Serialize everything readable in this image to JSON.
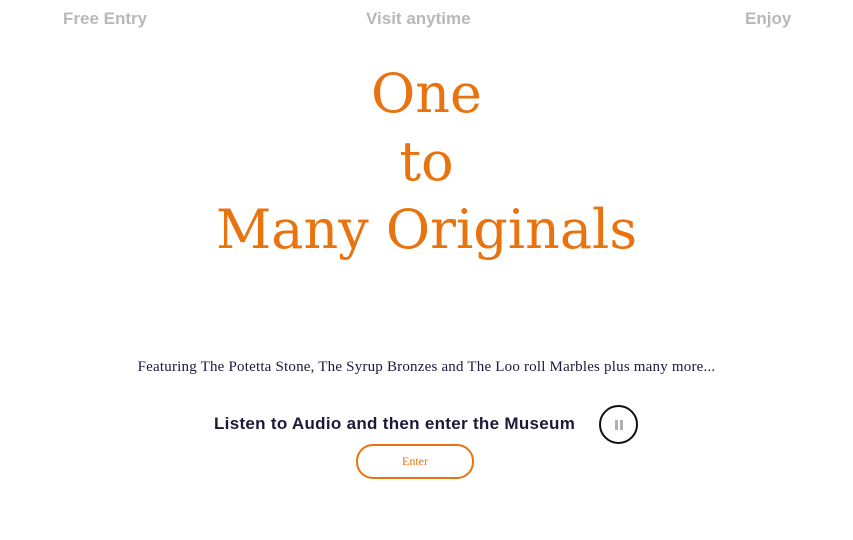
{
  "nav": {
    "left": "Free Entry",
    "center": "Visit anytime",
    "right": "Enjoy"
  },
  "hero": {
    "line1": "One",
    "line2": "to",
    "line3": "Many Originals"
  },
  "featuring": "Featuring The Potetta Stone, The Syrup Bronzes and The Loo roll Marbles plus many more...",
  "audio": {
    "label": "Listen to Audio and then enter the Museum",
    "control_icon": "pause-icon"
  },
  "enter_button": {
    "label": "Enter"
  },
  "colors": {
    "accent": "#e8730f",
    "nav_text": "#b8b8b8",
    "body_text": "#1a1a3a"
  }
}
